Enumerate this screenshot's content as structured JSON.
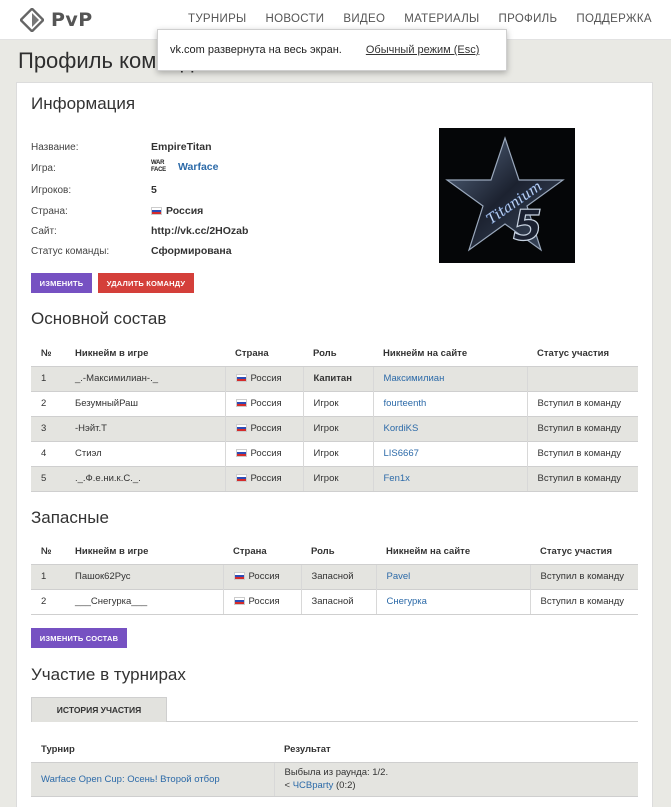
{
  "header": {
    "logo_text": "PvP",
    "nav": [
      "ТУРНИРЫ",
      "НОВОСТИ",
      "ВИДЕО",
      "МАТЕРИАЛЫ",
      "ПРОФИЛЬ",
      "ПОДДЕРЖКА"
    ]
  },
  "fullscreen_notice": {
    "message": "vk.com развернута на весь экран.",
    "exit_label": "Обычный режим (Esc)"
  },
  "page_title": "Профиль команды",
  "info": {
    "heading": "Информация",
    "rows": [
      {
        "label": "Название:",
        "value": "EmpireTitan"
      },
      {
        "label": "Игра:",
        "value": "Warface",
        "logo": "WAR FACE"
      },
      {
        "label": "Игроков:",
        "value": "5"
      },
      {
        "label": "Страна:",
        "value": "Россия"
      },
      {
        "label": "Сайт:",
        "value": "http://vk.cc/2HOzab"
      },
      {
        "label": "Статус команды:",
        "value": "Сформирована"
      }
    ],
    "avatar_text": "Titanium",
    "avatar_number": "5",
    "edit_button": "ИЗМЕНИТЬ",
    "delete_button": "УДАЛИТЬ КОМАНДУ"
  },
  "main_roster": {
    "heading": "Основной состав",
    "columns": [
      "№",
      "Никнейм в игре",
      "Страна",
      "Роль",
      "Никнейм на сайте",
      "Статус участия"
    ],
    "rows": [
      [
        "1",
        "_.-Максимилиан-._",
        "Россия",
        "Капитан",
        "Максимилиан",
        ""
      ],
      [
        "2",
        "БезумныйРаш",
        "Россия",
        "Игрок",
        "fourteenth",
        "Вступил в команду"
      ],
      [
        "3",
        "-Нэйт.Т",
        "Россия",
        "Игрок",
        "KordiKS",
        "Вступил в команду"
      ],
      [
        "4",
        "Стиэл",
        "Россия",
        "Игрок",
        "LIS6667",
        "Вступил в команду"
      ],
      [
        "5",
        "._.Ф.е.ни.к.С._.",
        "Россия",
        "Игрок",
        "Fen1x",
        "Вступил в команду"
      ]
    ]
  },
  "reserve": {
    "heading": "Запасные",
    "columns": [
      "№",
      "Никнейм в игре",
      "Страна",
      "Роль",
      "Никнейм на сайте",
      "Статус участия"
    ],
    "rows": [
      [
        "1",
        "Пашок62Рус",
        "Россия",
        "Запасной",
        "Pavel",
        "Вступил в команду"
      ],
      [
        "2",
        "___Снегурка___",
        "Россия",
        "Запасной",
        "Снегурка",
        "Вступил в команду"
      ]
    ],
    "edit_button": "ИЗМЕНИТЬ СОСТАВ"
  },
  "tournaments": {
    "heading": "Участие в турнирах",
    "tab": "ИСТОРИЯ УЧАСТИЯ",
    "columns": [
      "Турнир",
      "Результат"
    ],
    "rows": [
      {
        "tournament": "Warface Open Cup: Осень! Второй отбор",
        "result_line1": "Выбыла из раунда: 1/2.",
        "result_prefix": "<",
        "opponent": "ЧСВparty",
        "score": "(0:2)"
      }
    ]
  },
  "colors": {
    "purple_button": "#7651c2",
    "red_button": "#d43f3a",
    "link": "#2c6aa8"
  }
}
